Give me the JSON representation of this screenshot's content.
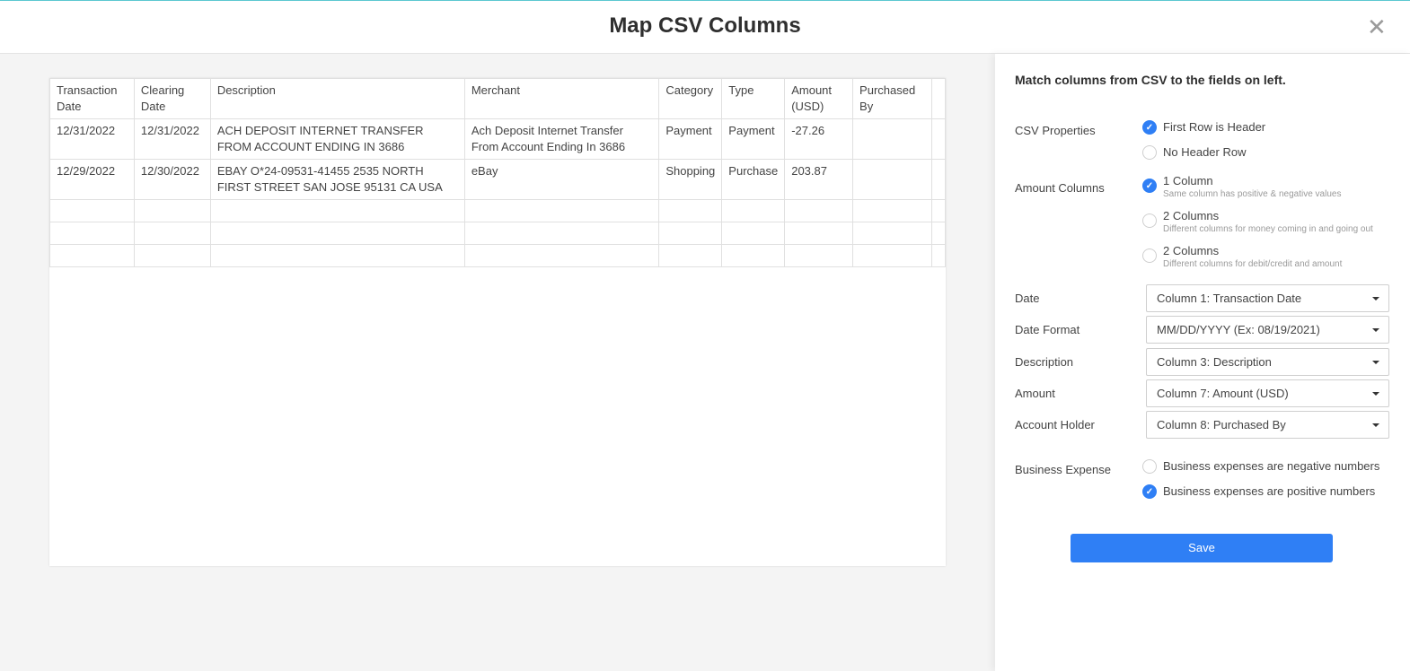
{
  "header": {
    "title": "Map CSV Columns",
    "close_icon": "close-icon"
  },
  "table": {
    "columns": [
      "Transaction Date",
      "Clearing Date",
      "Description",
      "Merchant",
      "Category",
      "Type",
      "Amount (USD)",
      "Purchased By",
      ""
    ],
    "rows": [
      [
        "12/31/2022",
        "12/31/2022",
        "ACH DEPOSIT INTERNET TRANSFER FROM ACCOUNT ENDING IN 3686",
        "Ach Deposit Internet Transfer From Account Ending In 3686",
        "Payment",
        "Payment",
        "-27.26",
        "",
        ""
      ],
      [
        "12/29/2022",
        "12/30/2022",
        "EBAY O*24-09531-41455 2535 NORTH FIRST STREET SAN JOSE 95131 CA USA",
        "eBay",
        "Shopping",
        "Purchase",
        "203.87",
        "",
        ""
      ],
      [
        "",
        "",
        "",
        "",
        "",
        "",
        "",
        "",
        ""
      ],
      [
        "",
        "",
        "",
        "",
        "",
        "",
        "",
        "",
        ""
      ],
      [
        "",
        "",
        "",
        "",
        "",
        "",
        "",
        "",
        ""
      ]
    ]
  },
  "panel": {
    "heading": "Match columns from CSV to the fields on left.",
    "csv_properties": {
      "label": "CSV Properties",
      "options": [
        {
          "label": "First Row is Header",
          "checked": true
        },
        {
          "label": "No Header Row",
          "checked": false
        }
      ]
    },
    "amount_columns": {
      "label": "Amount Columns",
      "options": [
        {
          "label": "1 Column",
          "sub": "Same column has positive & negative values",
          "checked": true
        },
        {
          "label": "2 Columns",
          "sub": "Different columns for money coming in and going out",
          "checked": false
        },
        {
          "label": "2 Columns",
          "sub": "Different columns for debit/credit and amount",
          "checked": false
        }
      ]
    },
    "fields": [
      {
        "label": "Date",
        "value": "Column 1: Transaction Date"
      },
      {
        "label": "Date Format",
        "value": "MM/DD/YYYY (Ex: 08/19/2021)"
      },
      {
        "label": "Description",
        "value": "Column 3: Description"
      },
      {
        "label": "Amount",
        "value": "Column 7: Amount (USD)"
      },
      {
        "label": "Account Holder",
        "value": "Column 8: Purchased By"
      }
    ],
    "business_expense": {
      "label": "Business Expense",
      "options": [
        {
          "label": "Business expenses are negative numbers",
          "checked": false
        },
        {
          "label": "Business expenses are positive numbers",
          "checked": true
        }
      ]
    },
    "save_label": "Save",
    "accent_color": "#2f7ff5"
  }
}
